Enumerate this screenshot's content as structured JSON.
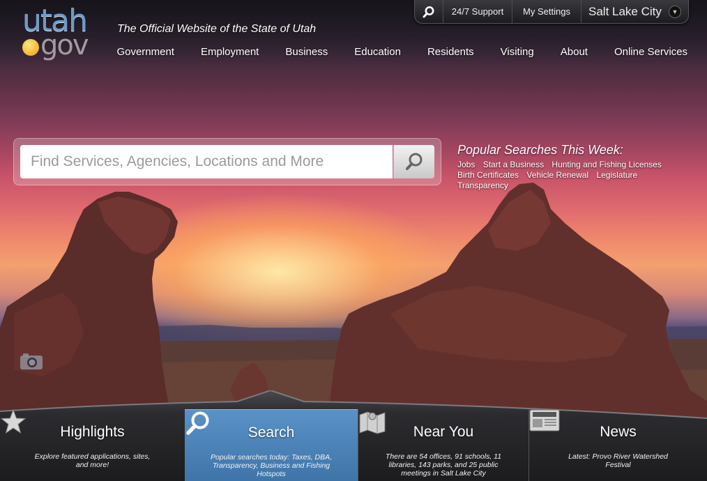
{
  "header": {
    "logo_utah": "utah",
    "logo_gov": "gov",
    "tagline": "The Official Website of the State of Utah"
  },
  "utility": {
    "support_label": "24/7 Support",
    "settings_label": "My Settings",
    "city": "Salt Lake City",
    "search_icon": "search-icon",
    "chevron_icon": "chevron-down-icon"
  },
  "nav": {
    "items": [
      "Government",
      "Employment",
      "Business",
      "Education",
      "Residents",
      "Visiting",
      "About",
      "Online Services"
    ]
  },
  "search": {
    "placeholder": "Find Services, Agencies, Locations and More",
    "button_icon": "search-icon"
  },
  "popular": {
    "title": "Popular Searches This Week:",
    "row1": [
      "Jobs",
      "Start a Business",
      "Hunting and Fishing Licenses"
    ],
    "row2": [
      "Birth Certificates",
      "Vehicle Renewal",
      "Legislature",
      "Transparency"
    ]
  },
  "camera_icon": "camera-icon",
  "tabs": {
    "highlights": {
      "title": "Highlights",
      "icon": "star-icon",
      "desc": "Explore featured applications, sites, and more!"
    },
    "search": {
      "title": "Search",
      "icon": "search-icon",
      "desc": "Popular searches today: Taxes, DBA, Transparency, Business and Fishing Hotspots"
    },
    "near": {
      "title": "Near You",
      "icon": "map-icon",
      "desc": "There are 54 offices, 91 schools, 11 libraries, 143 parks, and 25 public meetings in Salt Lake City"
    },
    "news": {
      "title": "News",
      "icon": "newspaper-icon",
      "desc": "Latest: Provo River Watershed Festival"
    }
  },
  "colors": {
    "active_tab": "#4f86bd",
    "logo_blue": "#6d9ac8",
    "sun": "#f3b52e"
  }
}
